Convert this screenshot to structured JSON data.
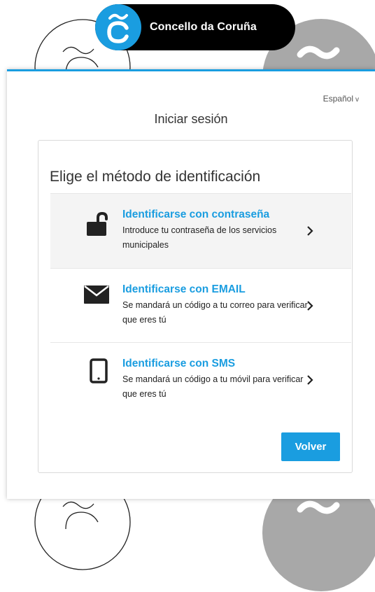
{
  "brand": {
    "name": "Concello da Coruña",
    "logo_icon": "tilde-c-logo-icon",
    "accent": "#1a9de0"
  },
  "panel": {
    "language": "Español",
    "title": "Iniciar sesión",
    "heading": "Elige el método de identificación",
    "options": [
      {
        "title": "Identificarse con contraseña",
        "description": "Introduce tu contraseña de los servicios municipales",
        "icon": "unlocked-padlock-icon"
      },
      {
        "title": "Identificarse con EMAIL",
        "description": "Se mandará un código a tu correo para verificar que eres tú",
        "icon": "envelope-icon"
      },
      {
        "title": "Identificarse con SMS",
        "description": "Se mandará un código a tu móvil para verificar que eres tú",
        "icon": "mobile-phone-icon"
      }
    ],
    "back_button": "Volver"
  }
}
